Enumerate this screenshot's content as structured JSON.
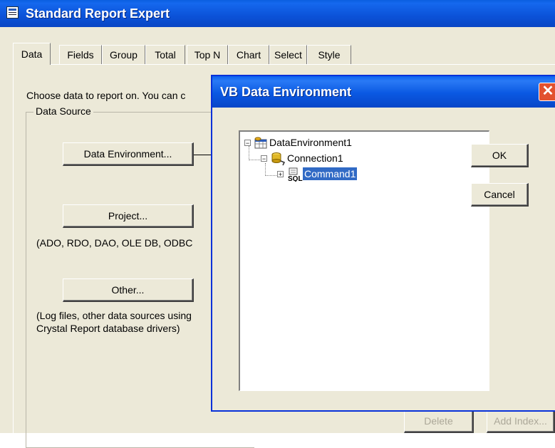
{
  "window": {
    "title": "Standard Report Expert"
  },
  "tabs": [
    {
      "label": "Data",
      "active": true
    },
    {
      "label": "Fields",
      "active": false
    },
    {
      "label": "Group",
      "active": false
    },
    {
      "label": "Total",
      "active": false
    },
    {
      "label": "Top N",
      "active": false
    },
    {
      "label": "Chart",
      "active": false
    },
    {
      "label": "Select",
      "active": false
    },
    {
      "label": "Style",
      "active": false
    }
  ],
  "data_tab": {
    "instruction": "Choose data to report on. You can c",
    "group_label": "Data Source",
    "buttons": {
      "data_environment": "Data Environment...",
      "project": "Project...",
      "other": "Other..."
    },
    "project_note": "(ADO, RDO, DAO, OLE DB, ODBC",
    "other_note_line1": "(Log files, other data sources using",
    "other_note_line2": "Crystal Report database drivers)",
    "behind_buttons": {
      "delete": "Delete",
      "add_index": "Add Index..."
    }
  },
  "dialog": {
    "title": "VB Data Environment",
    "close_glyph": "✕",
    "tree": [
      {
        "label": "DataEnvironment1",
        "icon": "data-environment-icon",
        "expanded": true
      },
      {
        "label": "Connection1",
        "icon": "connection-icon",
        "expanded": true
      },
      {
        "label": "Command1",
        "icon": "sql-command-icon",
        "expanded": false,
        "selected": true
      }
    ],
    "ok_label": "OK",
    "cancel_label": "Cancel"
  },
  "colors": {
    "titlebar": "#0a50d8",
    "face": "#ECE9D8",
    "selection": "#316ac5",
    "close_button": "#e2512f"
  }
}
